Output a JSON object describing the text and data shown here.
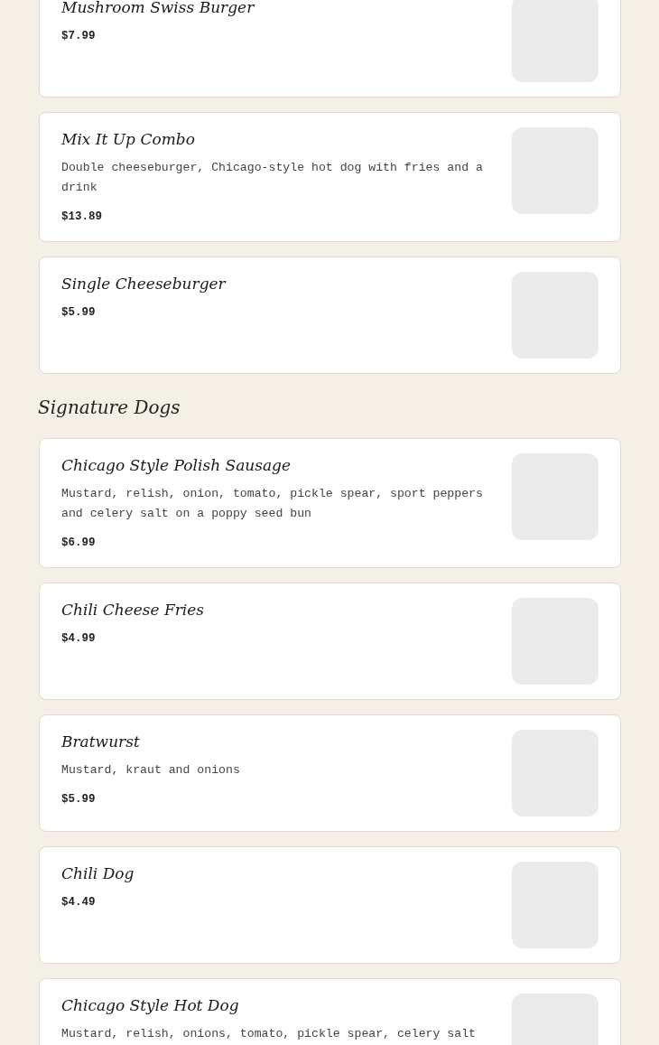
{
  "sections": [
    {
      "items": [
        {
          "name": "Mushroom Swiss Burger",
          "price": "$7.99"
        },
        {
          "name": "Mix It Up Combo",
          "description": "Double cheeseburger, Chicago-style hot dog with fries and a drink",
          "price": "$13.89"
        },
        {
          "name": "Single Cheeseburger",
          "price": "$5.99"
        }
      ]
    },
    {
      "title": "Signature Dogs",
      "items": [
        {
          "name": "Chicago Style Polish Sausage",
          "description": "Mustard, relish, onion, tomato, pickle spear, sport peppers and celery salt on a poppy seed bun",
          "price": "$6.99"
        },
        {
          "name": "Chili Cheese Fries",
          "price": "$4.99"
        },
        {
          "name": "Bratwurst",
          "description": "Mustard, kraut and onions",
          "price": "$5.99"
        },
        {
          "name": "Chili Dog",
          "price": "$4.49"
        },
        {
          "name": "Chicago Style Hot Dog",
          "description": "Mustard, relish, onions, tomato, pickle spear, celery salt"
        }
      ]
    }
  ]
}
